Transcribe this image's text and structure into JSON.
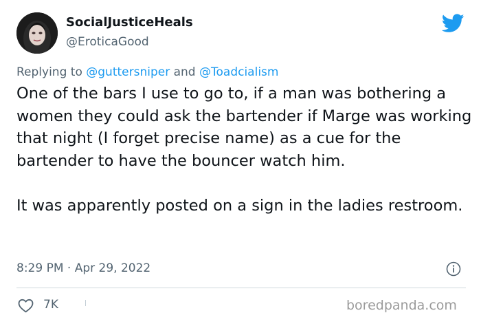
{
  "author": {
    "display_name": "SocialJusticeHeals",
    "handle": "@EroticaGood"
  },
  "icons": {
    "brand": "twitter-bird-icon",
    "info": "info-icon",
    "like": "heart-icon"
  },
  "reply": {
    "prefix": "Replying to ",
    "mention_1": "@guttersniper",
    "joiner": " and ",
    "mention_2": "@Toadcialism"
  },
  "tweet": {
    "paragraph_1": "One of the bars I use to go to, if a man was bothering a women they could ask the bartender if Marge was working that night (I forget precise name) as a cue for the bartender to have the bouncer watch him.",
    "paragraph_2": "It was apparently posted on a sign in the ladies restroom.",
    "timestamp": "8:29 PM · Apr 29, 2022"
  },
  "actions": {
    "like_count": "7K"
  },
  "watermark": "boredpanda.com",
  "colors": {
    "brand_blue": "#1d9bf0",
    "text_primary": "#0f1419",
    "text_secondary": "#536471",
    "divider": "#cfd9de"
  }
}
